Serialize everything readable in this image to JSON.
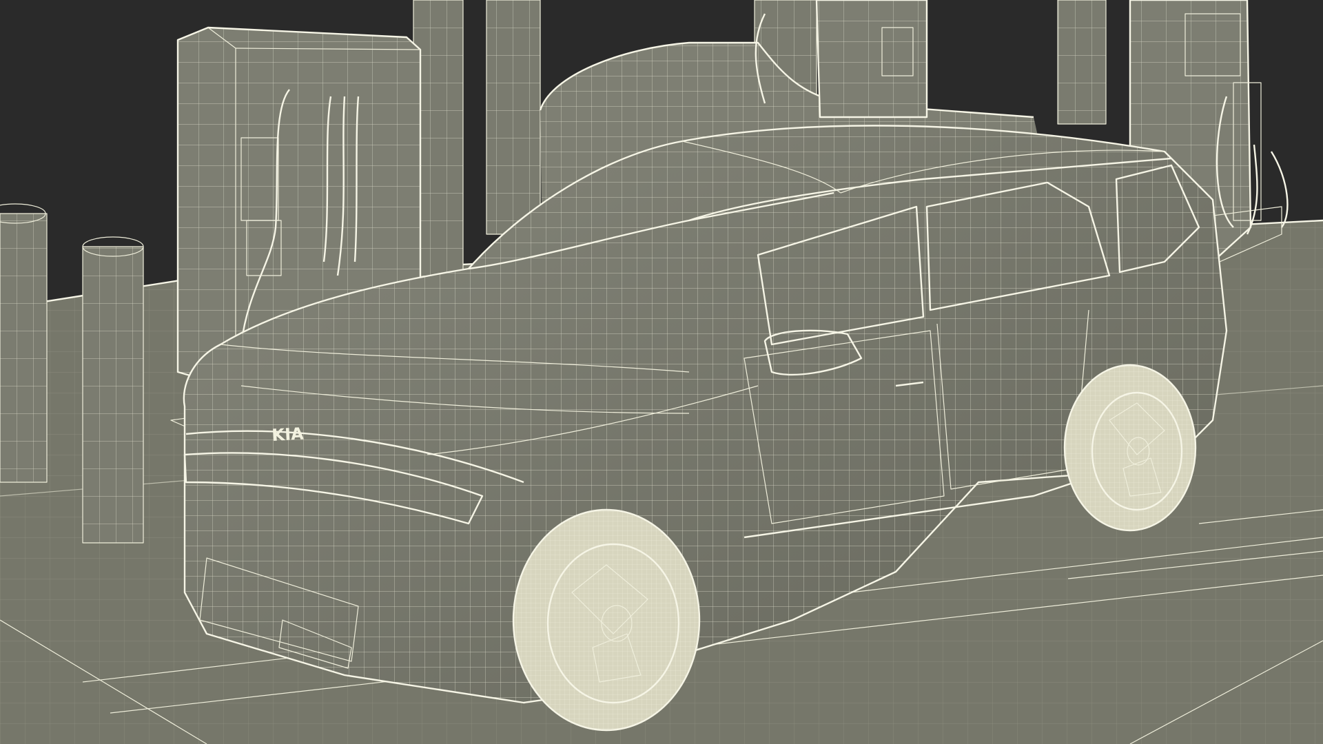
{
  "scene": {
    "colors": {
      "background": "#2a2a2a",
      "surface": "#76776a",
      "surface_light": "#82837a",
      "surface_dark": "#5e5f55",
      "wire": "#efeedb"
    },
    "badge_text": "KIA"
  }
}
